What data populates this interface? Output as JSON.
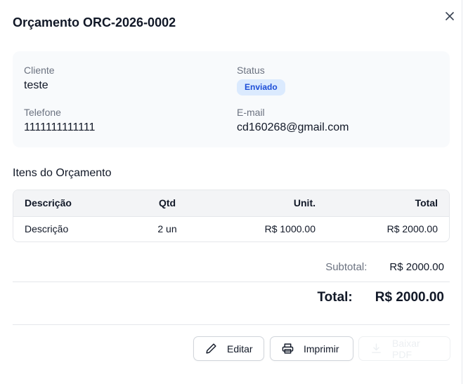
{
  "modal": {
    "title": "Orçamento ORC-2026-0002",
    "close_icon": "close-icon"
  },
  "info": {
    "client_label": "Cliente",
    "client_value": "teste",
    "status_label": "Status",
    "status_value": "Enviado",
    "phone_label": "Telefone",
    "phone_value": "1111111111111",
    "email_label": "E-mail",
    "email_value": "cd160268@gmail.com",
    "status_color": "#1d4ed8",
    "status_bg": "#dbeafe"
  },
  "items": {
    "section_title": "Itens do Orçamento",
    "columns": [
      "Descrição",
      "Qtd",
      "Unit.",
      "Total"
    ],
    "rows": [
      [
        "Descrição",
        "2 un",
        "R$ 1000.00",
        "R$ 2000.00"
      ]
    ]
  },
  "summary": {
    "subtotal_label": "Subtotal:",
    "subtotal_value": "R$ 2000.00",
    "total_label": "Total:",
    "total_value": "R$ 2000.00"
  },
  "actions": {
    "edit_label": "Editar",
    "edit_icon": "pencil-icon",
    "print_label": "Imprimir",
    "print_icon": "printer-icon",
    "pdf_label": "Baixar PDF",
    "pdf_icon": "download-icon"
  }
}
